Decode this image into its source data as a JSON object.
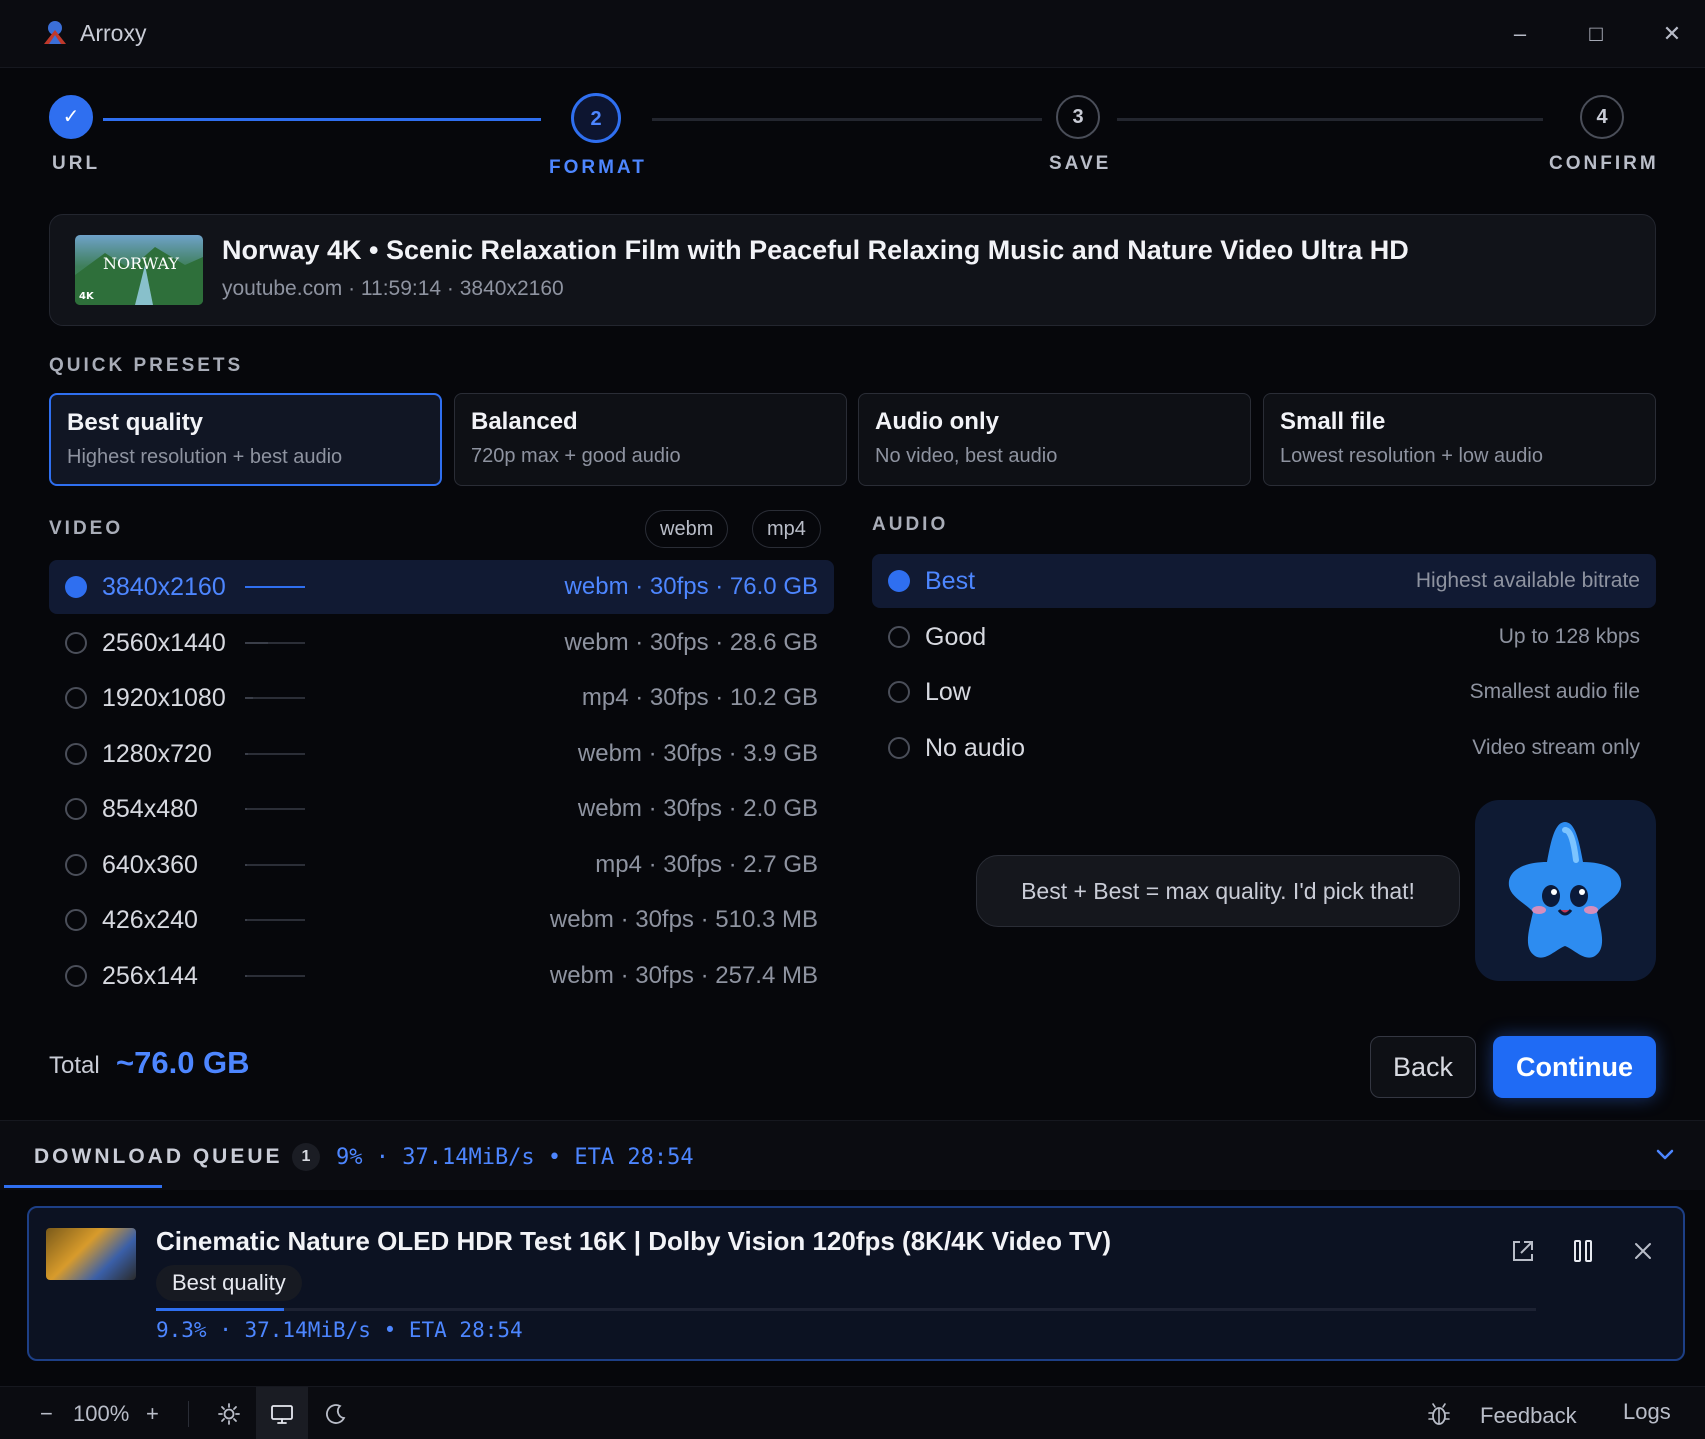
{
  "window": {
    "title": "Arroxy",
    "minimize": "–",
    "maximize": "□",
    "close": "✕"
  },
  "stepper": {
    "steps": [
      {
        "number": "✓",
        "label": "URL",
        "state": "done"
      },
      {
        "number": "2",
        "label": "FORMAT",
        "state": "active"
      },
      {
        "number": "3",
        "label": "SAVE",
        "state": "pending"
      },
      {
        "number": "4",
        "label": "CONFIRM",
        "state": "pending"
      }
    ]
  },
  "video": {
    "title": "Norway 4K • Scenic Relaxation Film with Peaceful Relaxing Music and Nature Video Ultra HD",
    "meta": "youtube.com · 11:59:14 · 3840x2160",
    "thumbnail_text": "NORWAY",
    "thumbnail_badge": "4K"
  },
  "presets": {
    "heading": "QUICK PRESETS",
    "items": [
      {
        "title": "Best quality",
        "subtitle": "Highest resolution + best audio",
        "active": true
      },
      {
        "title": "Balanced",
        "subtitle": "720p max + good audio",
        "active": false
      },
      {
        "title": "Audio only",
        "subtitle": "No video, best audio",
        "active": false
      },
      {
        "title": "Small file",
        "subtitle": "Lowest resolution + low audio",
        "active": false
      }
    ]
  },
  "video_formats": {
    "heading": "VIDEO",
    "filters": [
      "webm",
      "mp4"
    ],
    "rows": [
      {
        "resolution": "3840x2160",
        "info": "webm · 30fps · 76.0 GB",
        "bar": 1.0,
        "selected": true
      },
      {
        "resolution": "2560x1440",
        "info": "webm · 30fps · 28.6 GB",
        "bar": 0.38,
        "selected": false
      },
      {
        "resolution": "1920x1080",
        "info": "mp4 · 30fps · 10.2 GB",
        "bar": 0.13,
        "selected": false
      },
      {
        "resolution": "1280x720",
        "info": "webm · 30fps · 3.9 GB",
        "bar": 0.05,
        "selected": false
      },
      {
        "resolution": "854x480",
        "info": "webm · 30fps · 2.0 GB",
        "bar": 0.03,
        "selected": false
      },
      {
        "resolution": "640x360",
        "info": "mp4 · 30fps · 2.7 GB",
        "bar": 0.04,
        "selected": false
      },
      {
        "resolution": "426x240",
        "info": "webm · 30fps · 510.3 MB",
        "bar": 0.01,
        "selected": false
      },
      {
        "resolution": "256x144",
        "info": "webm · 30fps · 257.4 MB",
        "bar": 0.005,
        "selected": false
      }
    ]
  },
  "audio_formats": {
    "heading": "AUDIO",
    "rows": [
      {
        "label": "Best",
        "hint": "Highest available bitrate",
        "selected": true
      },
      {
        "label": "Good",
        "hint": "Up to 128 kbps",
        "selected": false
      },
      {
        "label": "Low",
        "hint": "Smallest audio file",
        "selected": false
      },
      {
        "label": "No audio",
        "hint": "Video stream only",
        "selected": false
      }
    ]
  },
  "mascot": {
    "speech": "Best + Best = max quality. I'd pick that!"
  },
  "summary": {
    "total_label": "Total",
    "total_value": "~76.0 GB"
  },
  "actions": {
    "back": "Back",
    "continue": "Continue"
  },
  "queue": {
    "title": "DOWNLOAD QUEUE",
    "count": "1",
    "status": "9% · 37.14MiB/s • ETA 28:54",
    "item": {
      "title": "Cinematic Nature OLED HDR Test 16K | Dolby Vision 120fps (8K/4K Video TV)",
      "badge": "Best quality",
      "progress": 0.093,
      "status": "9.3% · 37.14MiB/s • ETA 28:54"
    }
  },
  "statusbar": {
    "zoom_out": "−",
    "zoom": "100%",
    "zoom_in": "+",
    "feedback": "Feedback",
    "logs": "Logs"
  },
  "colors": {
    "accent": "#2f6ff0",
    "accent_text": "#4d86ff",
    "background": "#06070b",
    "panel": "#111319"
  }
}
